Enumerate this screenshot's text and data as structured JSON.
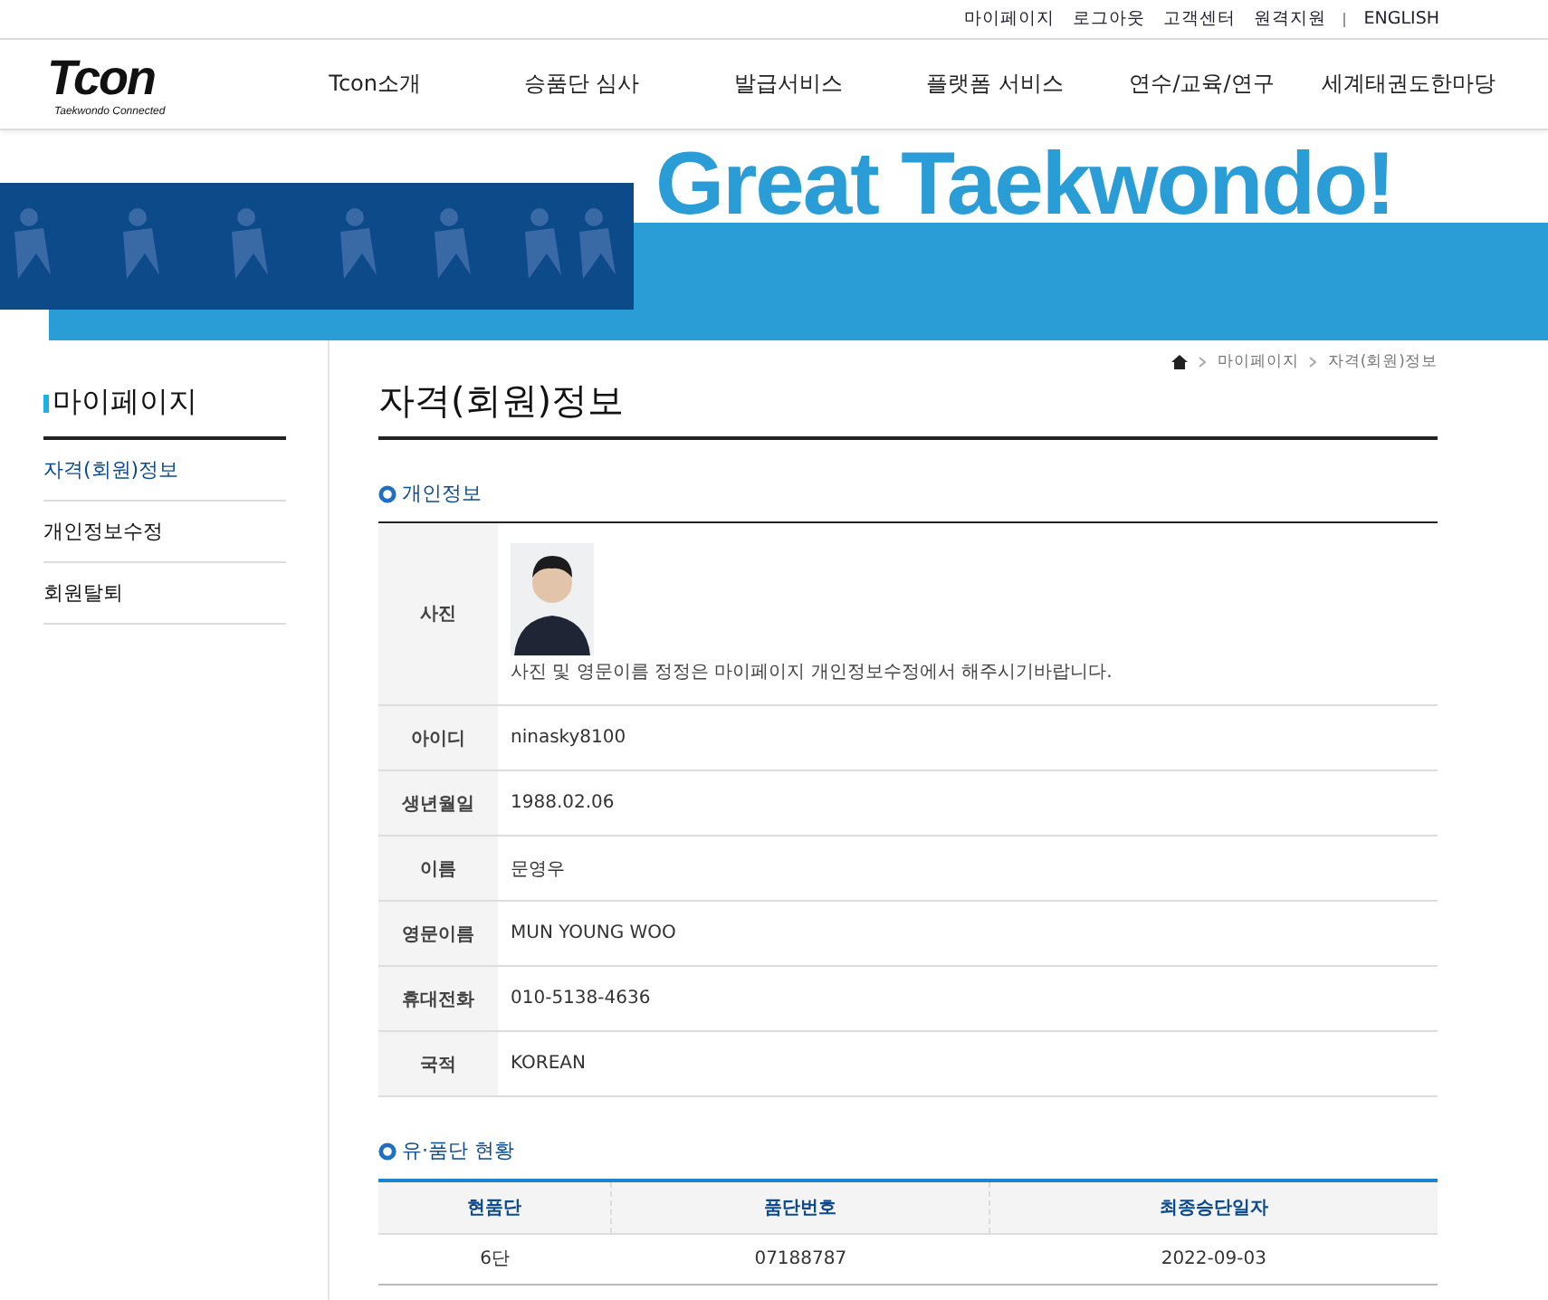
{
  "util_links": [
    "마이페이지",
    "로그아웃",
    "고객센터",
    "원격지원",
    "ENGLISH"
  ],
  "logo": {
    "name": "Tcon",
    "tagline": "Taekwondo Connected"
  },
  "nav": [
    "Tcon소개",
    "승품단 심사",
    "발급서비스",
    "플랫폼 서비스",
    "연수/교육/연구",
    "세계태권도한마당"
  ],
  "banner": {
    "headline": "Great Taekwondo!"
  },
  "sidebar": {
    "title": "마이페이지",
    "items": [
      {
        "label": "자격(회원)정보",
        "selected": true
      },
      {
        "label": "개인정보수정",
        "selected": false
      },
      {
        "label": "회원탈퇴",
        "selected": false
      }
    ]
  },
  "breadcrumb": [
    "마이페이지",
    "자격(회원)정보"
  ],
  "page_title": "자격(회원)정보",
  "personal": {
    "heading": "개인정보",
    "photo": {
      "label": "사진",
      "note": "사진 및 영문이름 정정은 마이페이지 개인정보수정에서 해주시기바랍니다."
    },
    "rows": [
      {
        "label": "아이디",
        "value": "ninasky8100"
      },
      {
        "label": "생년월일",
        "value": "1988.02.06"
      },
      {
        "label": "이름",
        "value": "문영우"
      },
      {
        "label": "영문이름",
        "value": "MUN YOUNG WOO"
      },
      {
        "label": "휴대전화",
        "value": "010-5138-4636"
      },
      {
        "label": "국적",
        "value": "KOREAN"
      }
    ]
  },
  "rank": {
    "heading": "유·품단 현황",
    "columns": [
      "현품단",
      "품단번호",
      "최종승단일자"
    ],
    "rows": [
      [
        "6단",
        "07188787",
        "2022-09-03"
      ]
    ]
  }
}
